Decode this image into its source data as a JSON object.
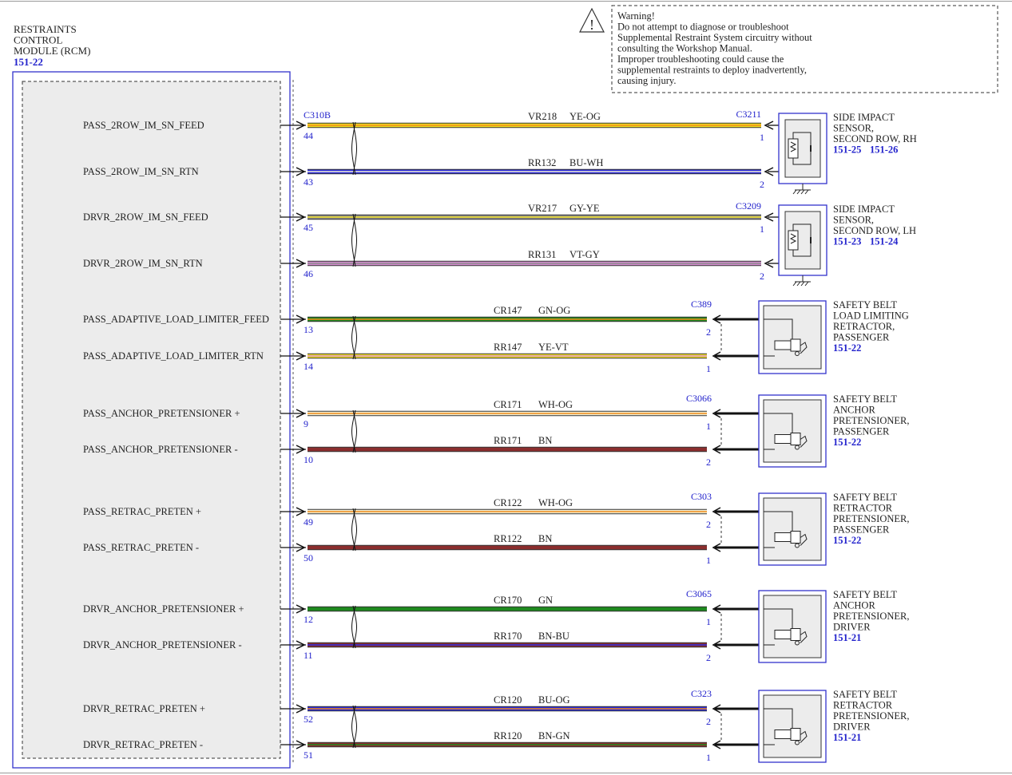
{
  "warning": {
    "lines": [
      "Warning!",
      "Do not attempt to diagnose or troubleshoot",
      "Supplemental Restraint System circuitry without",
      "consulting the Workshop Manual.",
      "Improper troubleshooting could cause the",
      "supplemental restraints to deploy inadvertently,",
      "causing injury."
    ],
    "icon": "warning-triangle-icon"
  },
  "module": {
    "title_lines": [
      "RESTRAINTS",
      "CONTROL",
      "MODULE (RCM)"
    ],
    "ref": "151-22"
  },
  "colors": {
    "YE": "#f2e022",
    "OG": "#f08a18",
    "BU": "#2b2be0",
    "WH": "#f4f1d6",
    "GY": "#8c8c8c",
    "VT": "#d58ad0",
    "GN": "#1f8a1f",
    "BN": "#8b2e2e",
    "link": "#2222cc",
    "border": "#3333cc"
  },
  "circuits": [
    {
      "signal": "PASS_2ROW_IM_SN_FEED",
      "module_pin": "44",
      "circuit": "VR218",
      "color": "YE-OG",
      "device_pin": "1"
    },
    {
      "signal": "PASS_2ROW_IM_SN_RTN",
      "module_pin": "43",
      "circuit": "RR132",
      "color": "BU-WH",
      "device_pin": "2"
    },
    {
      "signal": "DRVR_2ROW_IM_SN_FEED",
      "module_pin": "45",
      "circuit": "VR217",
      "color": "GY-YE",
      "device_pin": "1"
    },
    {
      "signal": "DRVR_2ROW_IM_SN_RTN",
      "module_pin": "46",
      "circuit": "RR131",
      "color": "VT-GY",
      "device_pin": "2"
    },
    {
      "signal": "PASS_ADAPTIVE_LOAD_LIMITER_FEED",
      "module_pin": "13",
      "circuit": "CR147",
      "color": "GN-OG",
      "device_pin": "2"
    },
    {
      "signal": "PASS_ADAPTIVE_LOAD_LIMITER_RTN",
      "module_pin": "14",
      "circuit": "RR147",
      "color": "YE-VT",
      "device_pin": "1"
    },
    {
      "signal": "PASS_ANCHOR_PRETENSIONER +",
      "module_pin": "9",
      "circuit": "CR171",
      "color": "WH-OG",
      "device_pin": "1"
    },
    {
      "signal": "PASS_ANCHOR_PRETENSIONER -",
      "module_pin": "10",
      "circuit": "RR171",
      "color": "BN",
      "device_pin": "2"
    },
    {
      "signal": "PASS_RETRAC_PRETEN +",
      "module_pin": "49",
      "circuit": "CR122",
      "color": "WH-OG",
      "device_pin": "2"
    },
    {
      "signal": "PASS_RETRAC_PRETEN -",
      "module_pin": "50",
      "circuit": "RR122",
      "color": "BN",
      "device_pin": "1"
    },
    {
      "signal": "DRVR_ANCHOR_PRETENSIONER +",
      "module_pin": "12",
      "circuit": "CR170",
      "color": "GN",
      "device_pin": "1"
    },
    {
      "signal": "DRVR_ANCHOR_PRETENSIONER -",
      "module_pin": "11",
      "circuit": "RR170",
      "color": "BN-BU",
      "device_pin": "2"
    },
    {
      "signal": "DRVR_RETRAC_PRETEN +",
      "module_pin": "52",
      "circuit": "CR120",
      "color": "BU-OG",
      "device_pin": "2"
    },
    {
      "signal": "DRVR_RETRAC_PRETEN -",
      "module_pin": "51",
      "circuit": "RR120",
      "color": "BN-GN",
      "device_pin": "1"
    }
  ],
  "module_connector": "C310B",
  "devices": [
    {
      "kind": "sensor",
      "connector": "C3211",
      "name_lines": [
        "SIDE IMPACT",
        "SENSOR,",
        "SECOND ROW, RH"
      ],
      "refs": [
        "151-25",
        "151-26"
      ],
      "circuits": [
        0,
        1
      ]
    },
    {
      "kind": "sensor",
      "connector": "C3209",
      "name_lines": [
        "SIDE IMPACT",
        "SENSOR,",
        "SECOND ROW, LH"
      ],
      "refs": [
        "151-23",
        "151-24"
      ],
      "circuits": [
        2,
        3
      ]
    },
    {
      "kind": "squib",
      "connector": "C389",
      "name_lines": [
        "SAFETY BELT",
        "LOAD LIMITING",
        "RETRACTOR,",
        "PASSENGER"
      ],
      "refs": [
        "151-22"
      ],
      "circuits": [
        4,
        5
      ]
    },
    {
      "kind": "squib",
      "connector": "C3066",
      "name_lines": [
        "SAFETY BELT",
        "ANCHOR",
        "PRETENSIONER,",
        "PASSENGER"
      ],
      "refs": [
        "151-22"
      ],
      "circuits": [
        6,
        7
      ]
    },
    {
      "kind": "squib",
      "connector": "C303",
      "name_lines": [
        "SAFETY BELT",
        "RETRACTOR",
        "PRETENSIONER,",
        "PASSENGER"
      ],
      "refs": [
        "151-22"
      ],
      "circuits": [
        8,
        9
      ]
    },
    {
      "kind": "squib",
      "connector": "C3065",
      "name_lines": [
        "SAFETY BELT",
        "ANCHOR",
        "PRETENSIONER,",
        "DRIVER"
      ],
      "refs": [
        "151-21"
      ],
      "circuits": [
        10,
        11
      ]
    },
    {
      "kind": "squib",
      "connector": "C323",
      "name_lines": [
        "SAFETY BELT",
        "RETRACTOR",
        "PRETENSIONER,",
        "DRIVER"
      ],
      "refs": [
        "151-21"
      ],
      "circuits": [
        12,
        13
      ]
    }
  ]
}
